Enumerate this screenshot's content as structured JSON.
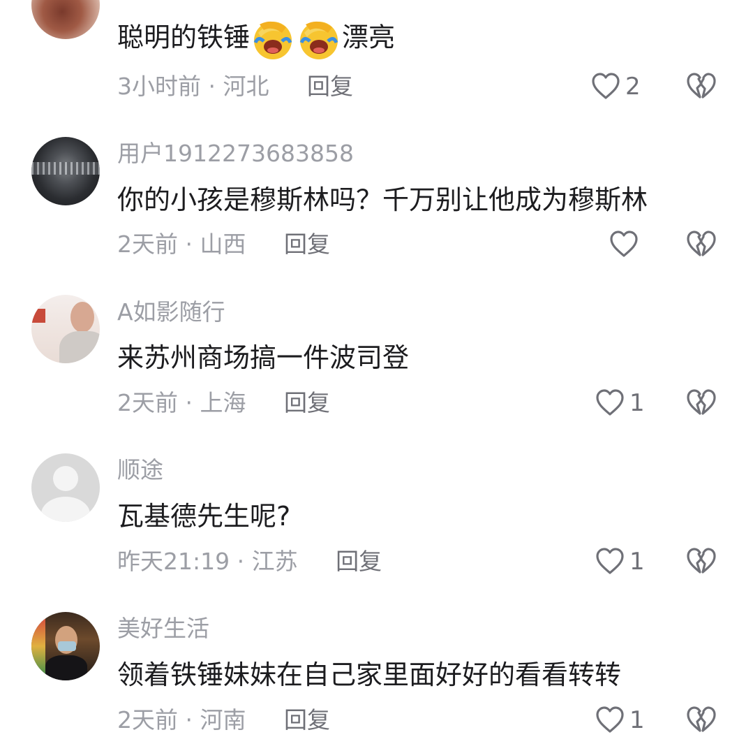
{
  "comments": [
    {
      "username": "",
      "text_prefix": "聪明的铁锤",
      "emojis": [
        "facepalm-laugh-emoji",
        "facepalm-laugh-emoji"
      ],
      "text_suffix": "漂亮",
      "time": "3小时前",
      "location": "河北",
      "reply_label": "回复",
      "likes": "2",
      "avatar_icon": "user-photo-avatar"
    },
    {
      "username": "用户1912273683858",
      "text": "你的小孩是穆斯林吗？千万别让他成为穆斯林",
      "time": "2天前",
      "location": "山西",
      "reply_label": "回复",
      "likes": "",
      "avatar_icon": "user-photo-avatar"
    },
    {
      "username": "A如影随行",
      "text": "来苏州商场搞一件波司登",
      "time": "2天前",
      "location": "上海",
      "reply_label": "回复",
      "likes": "1",
      "avatar_icon": "user-photo-avatar"
    },
    {
      "username": "顺途",
      "text": "瓦基德先生呢?",
      "time": "昨天21:19",
      "location": "江苏",
      "reply_label": "回复",
      "likes": "1",
      "avatar_icon": "default-user-avatar"
    },
    {
      "username": "美好生活",
      "text": "领着铁锤妹妹在自己家里面好好的看看转转",
      "time": "2天前",
      "location": "河南",
      "reply_label": "回复",
      "likes": "1",
      "avatar_icon": "user-photo-avatar"
    }
  ],
  "separator": "·",
  "icons": {
    "like": "heart-outline-icon",
    "dislike": "broken-heart-icon"
  },
  "colors": {
    "text": "#1c1c1f",
    "meta": "#9c9ea5",
    "reply": "#6f7077"
  }
}
